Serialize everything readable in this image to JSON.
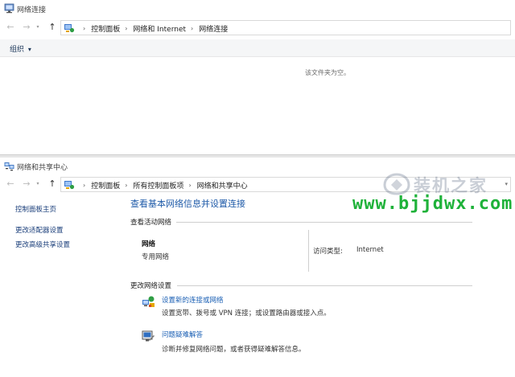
{
  "window1": {
    "title": "网络连接",
    "breadcrumb": [
      "控制面板",
      "网络和 Internet",
      "网络连接"
    ],
    "organize_label": "组织",
    "empty_message": "该文件夹为空。"
  },
  "window2": {
    "title": "网络和共享中心",
    "breadcrumb": [
      "控制面板",
      "所有控制面板项",
      "网络和共享中心"
    ],
    "sidebar": {
      "items": [
        "控制面板主页",
        "更改适配器设置",
        "更改高级共享设置"
      ]
    },
    "heading": "查看基本网络信息并设置连接",
    "active_networks_label": "查看活动网络",
    "network": {
      "name": "网络",
      "type": "专用网络",
      "access_label": "访问类型:",
      "access_value": "Internet"
    },
    "change_settings_label": "更改网络设置",
    "tasks": [
      {
        "link": "设置新的连接或网络",
        "desc": "设置宽带、拨号或 VPN 连接；或设置路由器或接入点。"
      },
      {
        "link": "问题疑难解答",
        "desc": "诊断并修复网络问题，或者获得疑难解答信息。"
      }
    ]
  },
  "nav": {
    "back": "←",
    "forward": "→",
    "up": "↑",
    "sep": "›",
    "dropdown": "▾"
  },
  "watermark": {
    "cn": "装机之家",
    "en": "www.bjjdwx.com"
  },
  "colors": {
    "link": "#1a5fb4",
    "heading": "#1e5aa8",
    "watermark_green": "#1fb23a"
  }
}
